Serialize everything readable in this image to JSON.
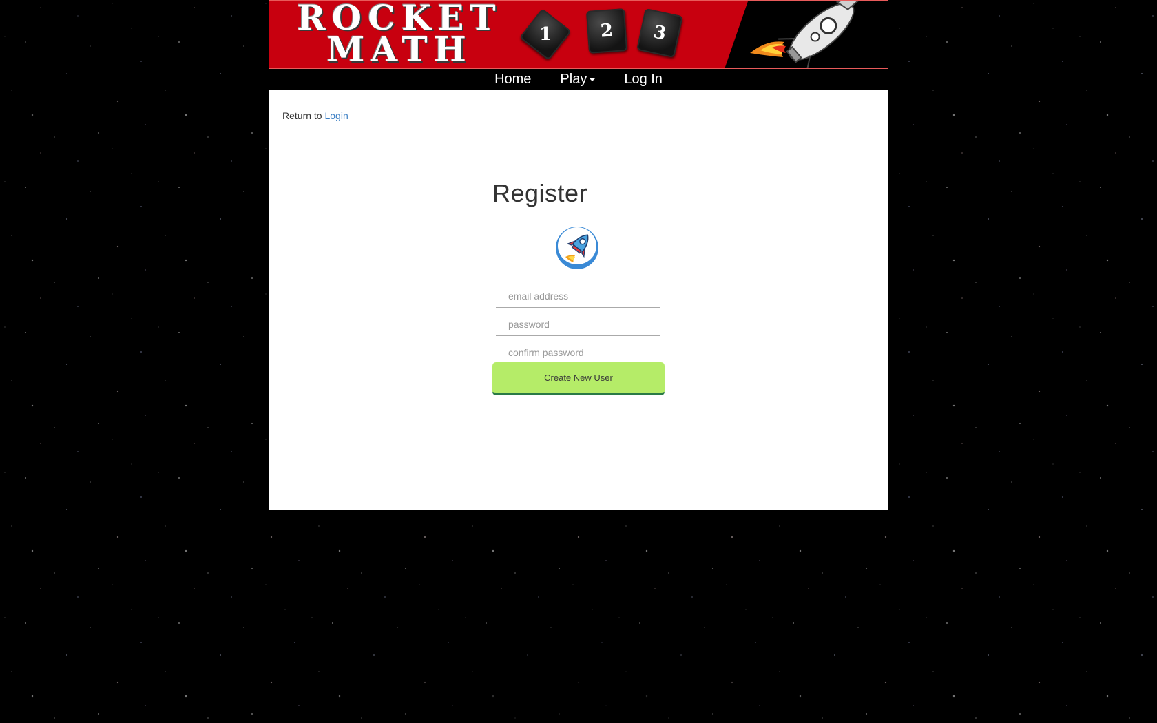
{
  "banner": {
    "logo_line1": "ROCKET",
    "logo_line2": "MATH",
    "dice": [
      "1",
      "2",
      "3"
    ],
    "background_color": "#c8000f"
  },
  "nav": {
    "home": "Home",
    "play": "Play",
    "login": "Log In"
  },
  "return_line": {
    "prefix": "Return to",
    "link": "Login"
  },
  "register": {
    "title": "Register",
    "avatar_icon": "rocket-icon",
    "email_placeholder": "email address",
    "password_placeholder": "password",
    "confirm_placeholder": "confirm password",
    "submit_label": "Create New User",
    "button_color": "#b5ec68",
    "link_color": "#3b7fc4"
  }
}
